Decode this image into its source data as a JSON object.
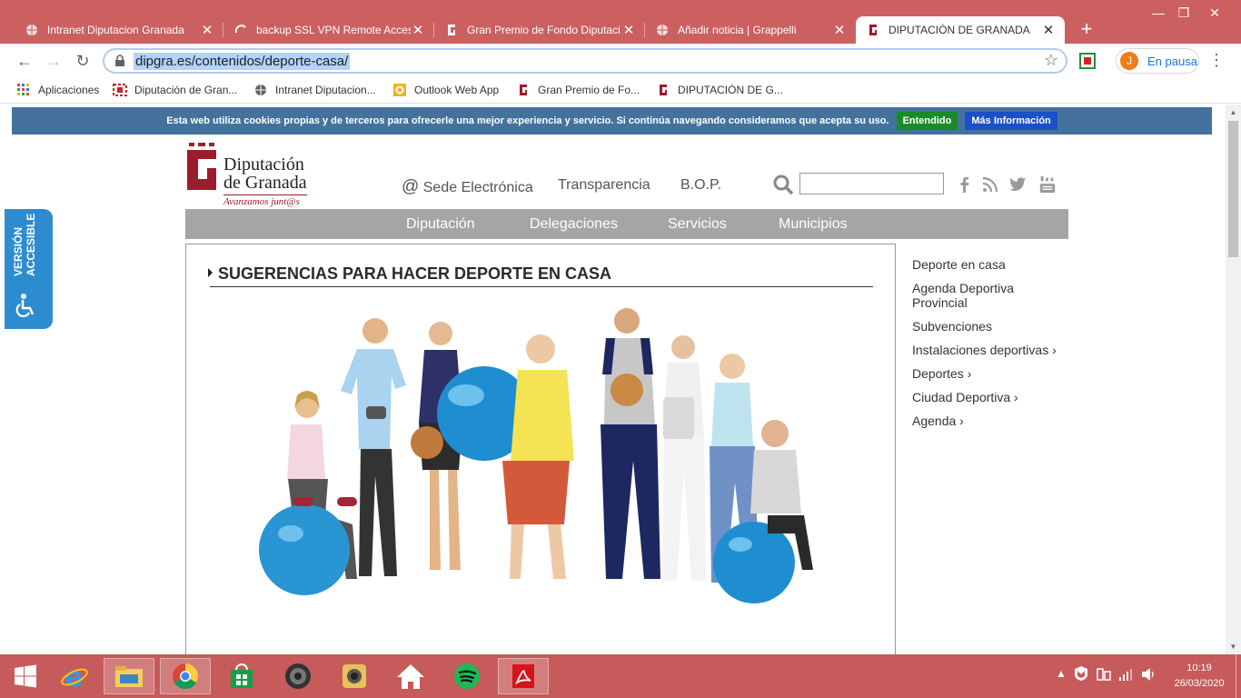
{
  "browser": {
    "tabs": [
      {
        "title": "Intranet Diputacion Granada",
        "icon": "globe-icon"
      },
      {
        "title": "backup SSL VPN Remote Acces",
        "icon": "loading-icon"
      },
      {
        "title": "Gran Premio de Fondo Diputaci",
        "icon": "dipgra-icon"
      },
      {
        "title": "Añadir noticia | Grappelli",
        "icon": "globe-icon"
      },
      {
        "title": "DIPUTACIÓN DE GRANADA",
        "icon": "dipgra-icon",
        "active": true
      }
    ],
    "close_glyph": "✕",
    "newtab_glyph": "+",
    "url": "dipgra.es/contenidos/deporte-casa/",
    "profile": {
      "initial": "J",
      "label": "En pausa"
    },
    "bookmarks": [
      {
        "label": "Aplicaciones",
        "icon": "apps-grid-icon"
      },
      {
        "label": "Diputación de Gran...",
        "icon": "dipgra-red-icon"
      },
      {
        "label": "Intranet Diputacion...",
        "icon": "globe-icon"
      },
      {
        "label": "Outlook Web App",
        "icon": "outlook-icon"
      },
      {
        "label": "Gran Premio de Fo...",
        "icon": "dipgra-icon"
      },
      {
        "label": "DIPUTACIÓN DE G...",
        "icon": "dipgra-icon"
      }
    ]
  },
  "cookie_bar": {
    "text": "Esta web utiliza cookies propias y de terceros para ofrecerle una mejor experiencia y servicio. Si continúa navegando consideramos que acepta su uso.",
    "accept_label": "Entendido",
    "more_label": "Más Información",
    "accept_color": "#1b8a2b",
    "more_color": "#1b50c8"
  },
  "accessible_tab": {
    "line1": "VERSIÓN",
    "line2": "ACCESIBLE"
  },
  "logo": {
    "line1": "Diputación",
    "line2": "de Granada",
    "tagline": "Avanzamos junt@s",
    "brand_color": "#9d1c2b"
  },
  "header_links": {
    "sede": "Sede Electrónica",
    "transparencia": "Transparencia",
    "bop": "B.O.P."
  },
  "search": {
    "placeholder": ""
  },
  "main_nav": [
    "Diputación",
    "Delegaciones",
    "Servicios",
    "Municipios"
  ],
  "content": {
    "title": "SUGERENCIAS PARA HACER DEPORTE EN CASA",
    "image": "group-exercise-photo"
  },
  "side_nav": [
    "Deporte en casa",
    "Agenda Deportiva Provincial",
    "Subvenciones",
    "Instalaciones deportivas ›",
    "Deportes ›",
    "Ciudad Deportiva ›",
    "Agenda ›"
  ],
  "taskbar": {
    "apps": [
      "windows-start-icon",
      "internet-explorer-icon",
      "file-explorer-icon",
      "chrome-icon",
      "store-icon",
      "speaker-app-icon",
      "camera-app-icon",
      "home-icon",
      "spotify-icon",
      "acrobat-icon"
    ],
    "time": "10:19",
    "date": "26/03/2020"
  }
}
